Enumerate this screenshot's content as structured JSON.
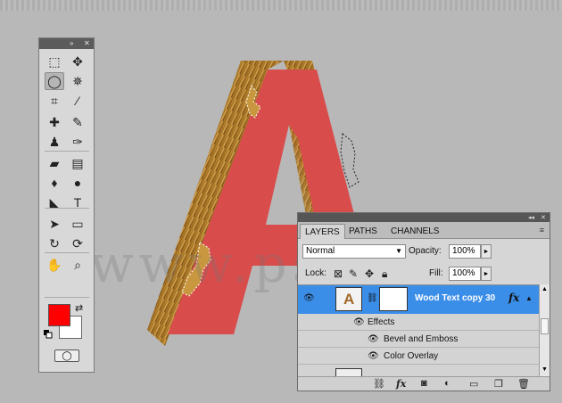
{
  "watermark": "www.psd-",
  "tools_panel": {
    "header_icons": [
      "collapse-icon",
      "close-icon"
    ],
    "tools": [
      {
        "name": "rect-marquee-tool-icon",
        "glyph": "⬚",
        "active": false
      },
      {
        "name": "move-tool-icon",
        "glyph": "✥",
        "active": false
      },
      {
        "name": "lasso-tool-icon",
        "glyph": "◯",
        "active": true
      },
      {
        "name": "magic-wand-tool-icon",
        "glyph": "✵",
        "active": false
      },
      {
        "name": "crop-tool-icon",
        "glyph": "⌗",
        "active": false
      },
      {
        "name": "eyedropper-tool-icon",
        "glyph": "⁄",
        "active": false
      },
      {
        "name": "healing-brush-tool-icon",
        "glyph": "✚",
        "active": false
      },
      {
        "name": "brush-tool-icon",
        "glyph": "✎",
        "active": false
      },
      {
        "name": "clone-stamp-tool-icon",
        "glyph": "♟",
        "active": false
      },
      {
        "name": "history-brush-tool-icon",
        "glyph": "✑",
        "active": false
      },
      {
        "name": "eraser-tool-icon",
        "glyph": "▰",
        "active": false
      },
      {
        "name": "gradient-tool-icon",
        "glyph": "▤",
        "active": false
      },
      {
        "name": "blur-tool-icon",
        "glyph": "♦",
        "active": false
      },
      {
        "name": "dodge-tool-icon",
        "glyph": "●",
        "active": false
      },
      {
        "name": "pen-tool-icon",
        "glyph": "◣",
        "active": false
      },
      {
        "name": "type-tool-icon",
        "glyph": "T",
        "active": false
      },
      {
        "name": "path-selection-tool-icon",
        "glyph": "➤",
        "active": false
      },
      {
        "name": "shape-tool-icon",
        "glyph": "▭",
        "active": false
      },
      {
        "name": "3d-rotate-tool-icon",
        "glyph": "↻",
        "active": false
      },
      {
        "name": "3d-orbit-tool-icon",
        "glyph": "⟳",
        "active": false
      },
      {
        "name": "hand-tool-icon",
        "glyph": "✋",
        "active": false
      },
      {
        "name": "zoom-tool-icon",
        "glyph": "⌕",
        "active": false
      }
    ],
    "foreground_color": "#ff0000",
    "background_color": "#ffffff"
  },
  "layers_panel": {
    "tabs": [
      {
        "label": "LAYERS",
        "active": true
      },
      {
        "label": "PATHS",
        "active": false
      },
      {
        "label": "CHANNELS",
        "active": false
      }
    ],
    "blend_mode": "Normal",
    "opacity_label": "Opacity:",
    "opacity_value": "100%",
    "lock_label": "Lock:",
    "fill_label": "Fill:",
    "fill_value": "100%",
    "layer": {
      "name": "Wood Text copy 30",
      "thumb_letter": "A",
      "fx_label": "fx"
    },
    "effects_label": "Effects",
    "effects": [
      "Bevel and Emboss",
      "Color Overlay"
    ],
    "selected_color": "#3b8ee8",
    "footer_icons": [
      "link-layers-icon",
      "fx-icon",
      "add-mask-icon",
      "adjustment-layer-icon",
      "new-group-icon",
      "new-layer-icon",
      "trash-icon"
    ]
  }
}
